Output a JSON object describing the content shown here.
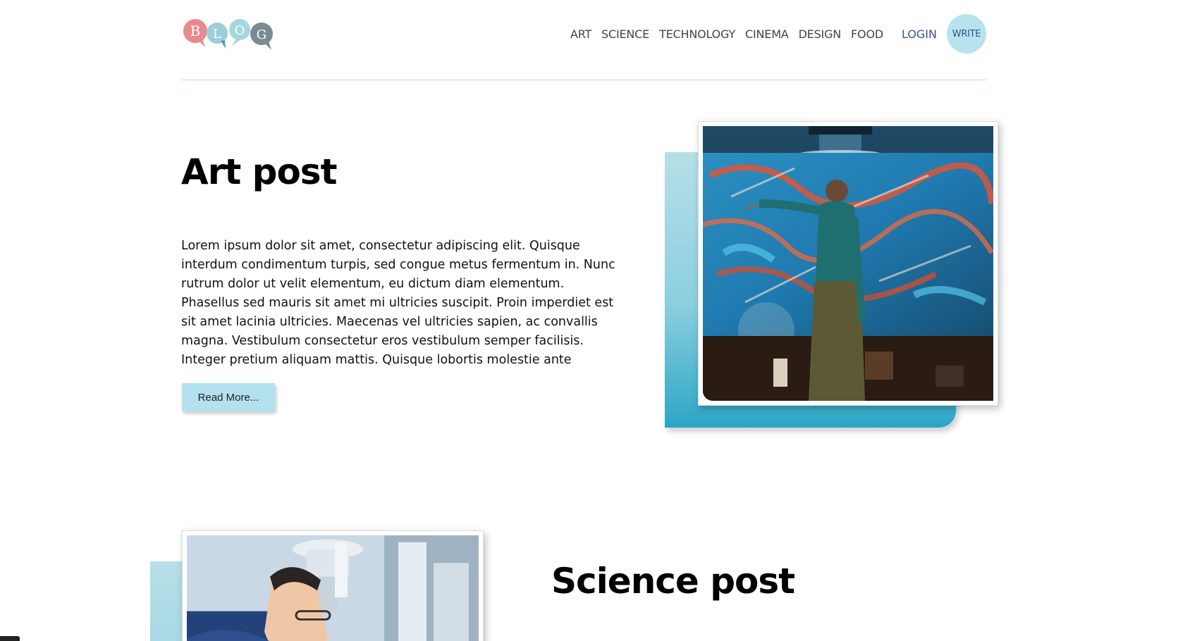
{
  "header": {
    "logo_text": "BLOG",
    "logo_colors": [
      "#e88a8e",
      "#9ccfd9",
      "#a6d6e0",
      "#7c8a95"
    ],
    "nav_items": [
      "ART",
      "SCIENCE",
      "TECHNOLOGY",
      "CINEMA",
      "DESIGN",
      "FOOD"
    ],
    "login_label": "LOGIN",
    "write_label": "WRITE"
  },
  "posts": [
    {
      "title": "Art post",
      "excerpt": "Lorem ipsum dolor sit amet, consectetur adipiscing elit. Quisque interdum condimentum turpis, sed congue metus fermentum in. Nunc rutrum dolor ut velit elementum, eu dictum diam elementum. Phasellus sed mauris sit amet mi ultricies suscipit. Proin imperdiet est sit amet lacinia ultricies. Maecenas vel ultricies sapien, ac convallis magna. Vestibulum consectetur eros vestibulum semper facilisis. Integer pretium aliquam mattis. Quisque lobortis molestie ante",
      "read_more_label": "Read More..."
    },
    {
      "title": "Science post"
    }
  ],
  "colors": {
    "accent": "#b3e2ee",
    "accent_dark": "#2ba6c6",
    "nav_text": "#444444",
    "login_text": "#3a4f9a"
  }
}
